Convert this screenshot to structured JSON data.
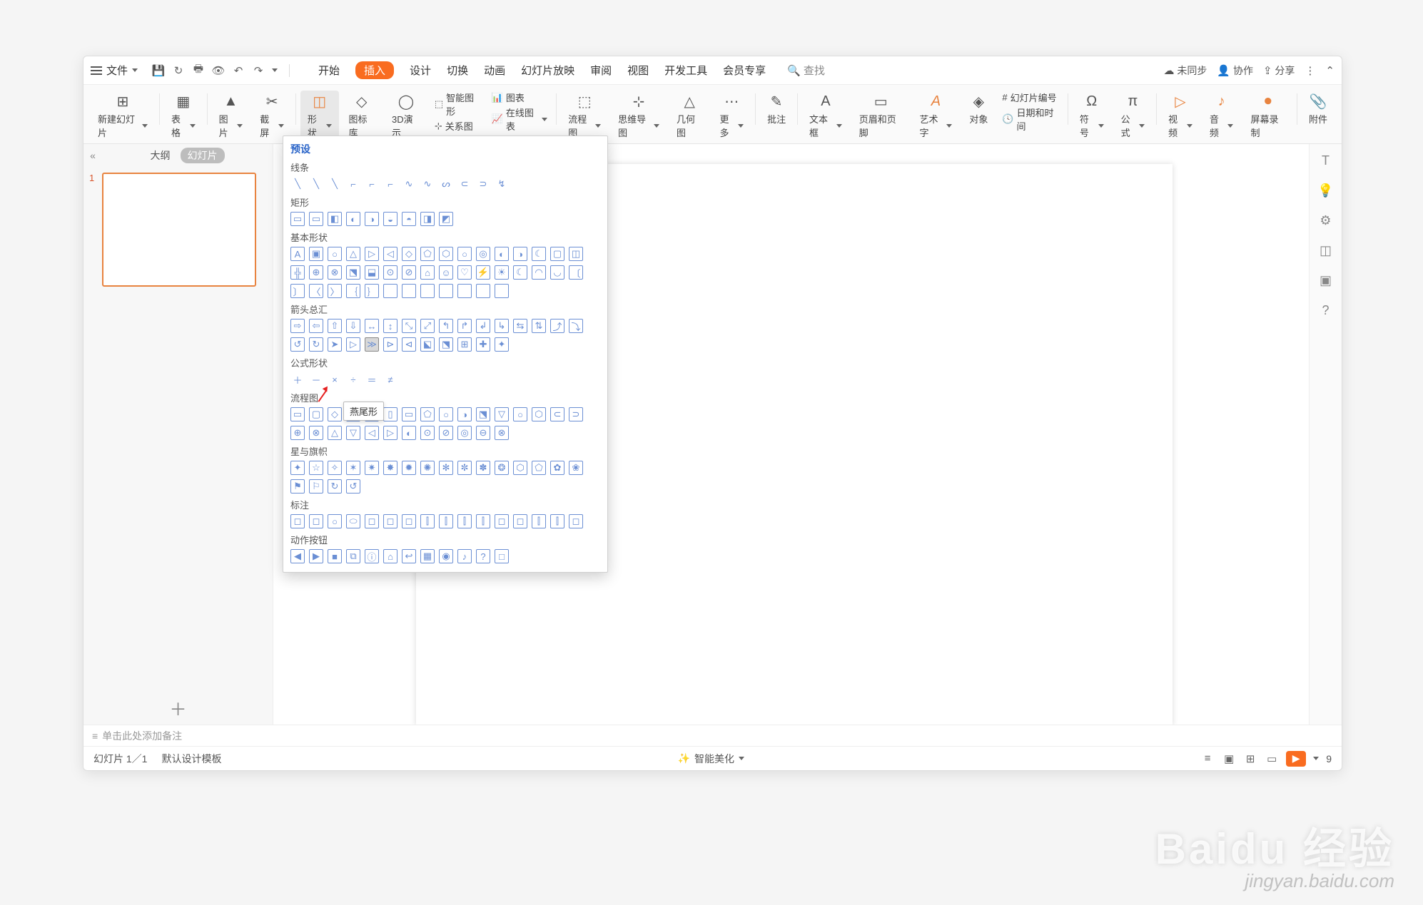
{
  "titlebar": {
    "file_label": "文件",
    "tabs": [
      "开始",
      "插入",
      "设计",
      "切换",
      "动画",
      "幻灯片放映",
      "审阅",
      "视图",
      "开发工具",
      "会员专享"
    ],
    "active_tab_index": 1,
    "search_placeholder": "查找",
    "sync_label": "未同步",
    "collab_label": "协作",
    "share_label": "分享"
  },
  "ribbon": {
    "groups": [
      {
        "label": "新建幻灯片",
        "icon": "⊞"
      },
      {
        "label": "表格",
        "icon": "▦"
      },
      {
        "label": "图片",
        "icon": "▲"
      },
      {
        "label": "截屏",
        "icon": "✂"
      },
      {
        "label": "形状",
        "icon": "◫",
        "selected": true
      },
      {
        "label": "图标库",
        "icon": "◇"
      },
      {
        "label": "3D演示",
        "icon": "◯"
      },
      {
        "label": "流程图",
        "icon": "⬚"
      },
      {
        "label": "思维导图",
        "icon": "⊹"
      },
      {
        "label": "几何图",
        "icon": "△"
      },
      {
        "label": "更多",
        "icon": "⋯"
      },
      {
        "label": "批注",
        "icon": "✎"
      },
      {
        "label": "文本框",
        "icon": "A"
      },
      {
        "label": "页眉和页脚",
        "icon": "▭"
      },
      {
        "label": "艺术字",
        "icon": "A"
      },
      {
        "label": "对象",
        "icon": "◈"
      },
      {
        "label": "日期和时间",
        "icon": "🕓"
      },
      {
        "label": "符号",
        "icon": "Ω"
      },
      {
        "label": "公式",
        "icon": "π"
      },
      {
        "label": "视频",
        "icon": "▷"
      },
      {
        "label": "音频",
        "icon": "♪"
      },
      {
        "label": "屏幕录制",
        "icon": "⏺"
      },
      {
        "label": "附件",
        "icon": "📎"
      }
    ],
    "small": {
      "smart_graphics": "智能图形",
      "relation": "关系图",
      "chart": "图表",
      "online_chart": "在线图表",
      "slide_number": "幻灯片编号"
    }
  },
  "left_panel": {
    "tab_outline": "大纲",
    "tab_slides": "幻灯片",
    "thumb_number": "1"
  },
  "notes_placeholder": "单击此处添加备注",
  "statusbar": {
    "slide_counter": "幻灯片 1／1",
    "template": "默认设计模板",
    "beautify": "智能美化",
    "zoom": "9"
  },
  "shapes_dropdown": {
    "title": "预设",
    "categories": [
      {
        "name": "线条",
        "count": 12
      },
      {
        "name": "矩形",
        "count": 9
      },
      {
        "name": "基本形状",
        "count": 44
      },
      {
        "name": "箭头总汇",
        "count": 28
      },
      {
        "name": "公式形状",
        "count": 6
      },
      {
        "name": "流程图",
        "count": 28
      },
      {
        "name": "星与旗帜",
        "count": 20
      },
      {
        "name": "标注",
        "count": 16
      },
      {
        "name": "动作按钮",
        "count": 12
      }
    ],
    "tooltip": "燕尾形"
  },
  "watermark": {
    "brand": "Baidu 经验",
    "url": "jingyan.baidu.com"
  }
}
